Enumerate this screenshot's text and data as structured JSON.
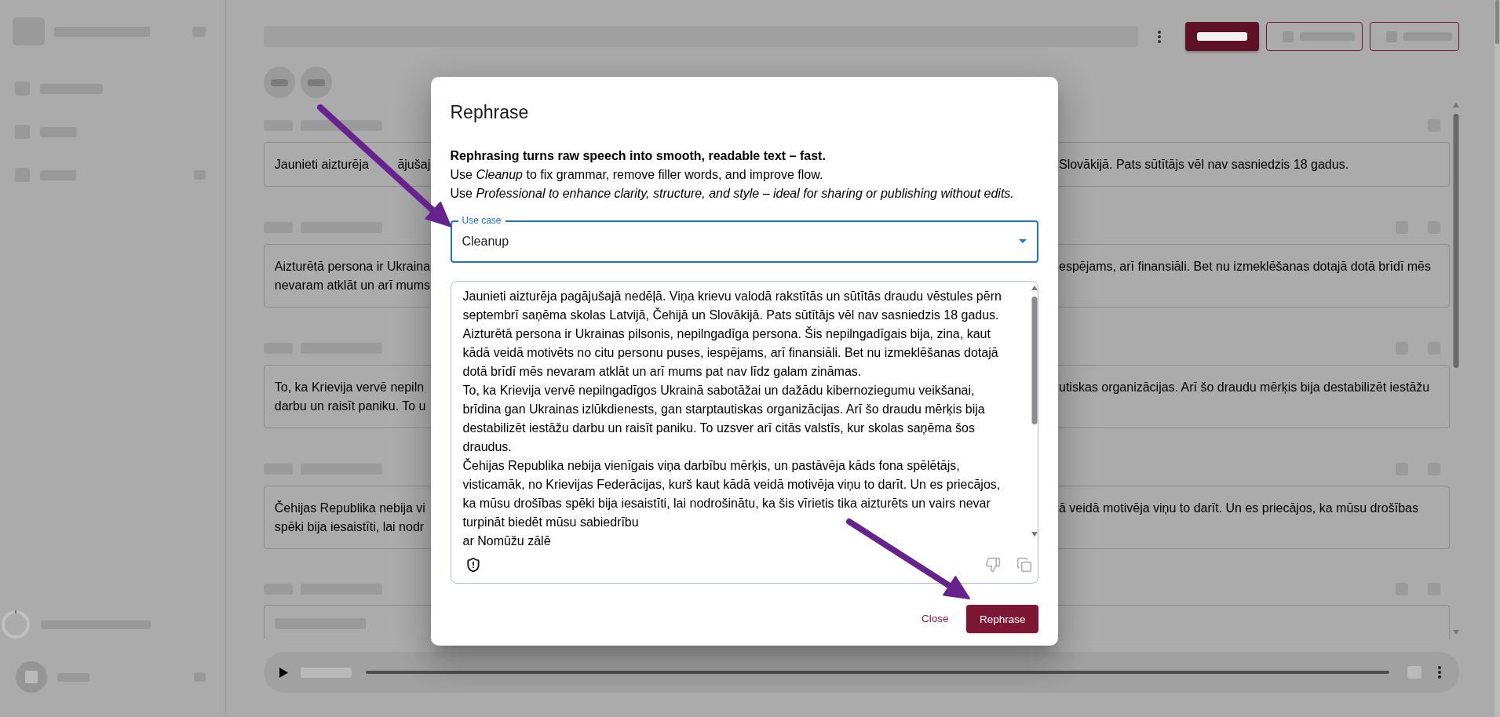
{
  "transcript": {
    "segments": [
      {
        "kind": "text",
        "lines": [
          {
            "left": [
              "Jaunieti aizturēja",
              "ājušaj"
            ],
            "right": "Slovākijā. Pats sūtītājs vēl nav sasniedzis 18 gadus."
          }
        ]
      },
      {
        "kind": "text",
        "lines": [
          {
            "left": [
              "Aizturētā persona ir Ukraina"
            ],
            "right": "espējams, arī finansiāli. Bet nu izmeklēšanas dotajā dotā brīdī mēs"
          },
          {
            "left": [
              "nevaram atklāt un arī mums"
            ]
          }
        ]
      },
      {
        "kind": "text",
        "lines": [
          {
            "left": [
              "To, ka Krievija vervē nepiln"
            ],
            "right": "utiskas organizācijas. Arī šo draudu mērķis bija destabilizēt iestāžu"
          },
          {
            "left": [
              "darbu un raisīt paniku. To u"
            ]
          }
        ]
      },
      {
        "kind": "text",
        "lines": [
          {
            "left": [
              "Čehijas Republika nebija vi"
            ],
            "right": "ā veidā motivēja viņu to darīt. Un es priecājos, ka mūsu drošības"
          },
          {
            "left": [
              "spēki bija iesaistīti, lai nodr"
            ]
          }
        ]
      },
      {
        "kind": "redacted"
      }
    ]
  },
  "dialog": {
    "title": "Rephrase",
    "heading": "Rephrasing turns raw speech into smooth, readable text – fast.",
    "help": [
      "Use *Cleanup* to fix grammar, remove filler words, and improve flow.",
      "Use *Professional to enhance clarity, structure, and style – ideal for sharing or publishing without edits.*"
    ],
    "use_case": {
      "label": "Use case",
      "value": "Cleanup",
      "focused": true
    },
    "output": {
      "value": "Jaunieti aizturēja pagājušajā nedēļā. Viņa krievu valodā rakstītās un sūtītās draudu vēstules pērn septembrī saņēma skolas Latvijā, Čehijā un Slovākijā. Pats sūtītājs vēl nav sasniedzis 18 gadus.\nAizturētā persona ir Ukrainas pilsonis, nepilngadīga persona. Šis nepilngadīgais bija, zina, kaut kādā veidā motivēts no citu personu puses, iespējams, arī finansiāli. Bet nu izmeklēšanas dotajā dotā brīdī mēs nevaram atklāt un arī mums pat nav līdz galam zināmas.\nTo, ka Krievija vervē nepilngadīgos Ukrainā sabotāžai un dažādu kibernoziegumu veikšanai, brīdina gan Ukrainas izlūkdienests, gan starptautiskas organizācijas. Arī šo draudu mērķis bija destabilizēt iestāžu darbu un raisīt paniku. To uzsver arī citās valstīs, kur skolas saņēma šos draudus.\nČehijas Republika nebija vienīgais viņa darbību mērķis, un pastāvēja kāds fona spēlētājs, visticamāk, no Krievijas Federācijas, kurš kaut kādā veidā motivēja viņu to darīt. Un es priecājos, ka mūsu drošības spēki bija iesaistīti, lai nodrošinātu, ka šis vīrietis tika aizturēts un vairs nevar turpināt biedēt mūsu sabiedrību\nar Nomūžu zālē"
    },
    "buttons": [
      {
        "label": "Close",
        "kind": "text"
      },
      {
        "label": "Rephrase",
        "kind": "contained"
      }
    ]
  }
}
